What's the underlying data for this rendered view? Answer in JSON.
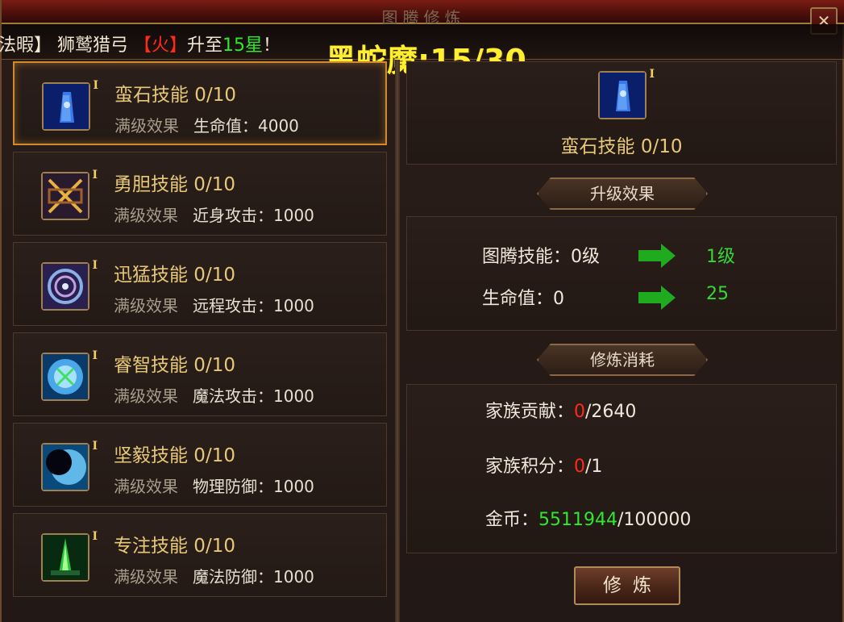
{
  "window": {
    "title": "图腾修炼"
  },
  "ticker": {
    "prefix": "法暇】 狮鹫猎弓 ",
    "element": "【火】",
    "mid": "升至",
    "stars": "15星",
    "suffix": "！"
  },
  "overlay": {
    "boss_progress": "黑蛇魔:15/30"
  },
  "skills": [
    {
      "name": "蛮石技能 0/10",
      "effect_label": "满级效果",
      "effect_value": "生命值：4000",
      "icon": "stone-icon",
      "tier": "I"
    },
    {
      "name": "勇胆技能 0/10",
      "effect_label": "满级效果",
      "effect_value": "近身攻击：1000",
      "icon": "crossed-blades-icon",
      "tier": "I"
    },
    {
      "name": "迅猛技能 0/10",
      "effect_label": "满级效果",
      "effect_value": "远程攻击：1000",
      "icon": "vortex-icon",
      "tier": "I"
    },
    {
      "name": "睿智技能 0/10",
      "effect_label": "满级效果",
      "effect_value": "魔法攻击：1000",
      "icon": "crystal-orb-icon",
      "tier": "I"
    },
    {
      "name": "坚毅技能 0/10",
      "effect_label": "满级效果",
      "effect_value": "物理防御：1000",
      "icon": "dark-eye-icon",
      "tier": "I"
    },
    {
      "name": "专注技能 0/10",
      "effect_label": "满级效果",
      "effect_value": "魔法防御：1000",
      "icon": "green-spire-icon",
      "tier": "I"
    }
  ],
  "selected": {
    "name": "蛮石技能 0/10",
    "tier": "I",
    "icon": "stone-icon"
  },
  "upgrade": {
    "header": "升级效果",
    "rows": [
      {
        "label": "图腾技能：0级",
        "next": "1级"
      },
      {
        "label": "生命值：0",
        "next": "25"
      }
    ]
  },
  "cost": {
    "header": "修炼消耗",
    "family_contribution": {
      "label": "家族贡献：",
      "have": "0",
      "need": "/2640"
    },
    "family_points": {
      "label": "家族积分：",
      "have": "0",
      "need": "/1"
    },
    "gold": {
      "label": "金币：",
      "have": "5511944",
      "need": "/100000"
    }
  },
  "actions": {
    "train_label": "修炼"
  },
  "colors": {
    "accent_gold": "#e8c978",
    "positive_green": "#2ee82e",
    "negative_red": "#ff2a1a"
  }
}
